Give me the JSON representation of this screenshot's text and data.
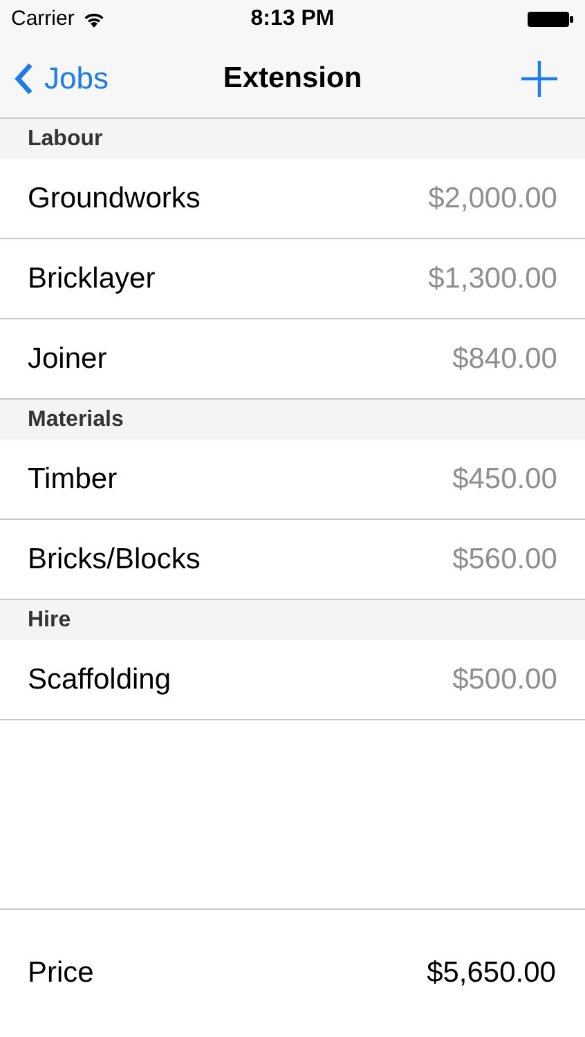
{
  "status_bar": {
    "carrier": "Carrier",
    "time": "8:13 PM"
  },
  "nav": {
    "back": "Jobs",
    "title": "Extension"
  },
  "sections": [
    {
      "title": "Labour",
      "rows": [
        {
          "name": "Groundworks",
          "amount": "$2,000.00"
        },
        {
          "name": "Bricklayer",
          "amount": "$1,300.00"
        },
        {
          "name": "Joiner",
          "amount": "$840.00"
        }
      ]
    },
    {
      "title": "Materials",
      "rows": [
        {
          "name": "Timber",
          "amount": "$450.00"
        },
        {
          "name": "Bricks/Blocks",
          "amount": "$560.00"
        }
      ]
    },
    {
      "title": "Hire",
      "rows": [
        {
          "name": "Scaffolding",
          "amount": "$500.00"
        }
      ]
    }
  ],
  "footer": {
    "label": "Price",
    "total": "$5,650.00"
  }
}
